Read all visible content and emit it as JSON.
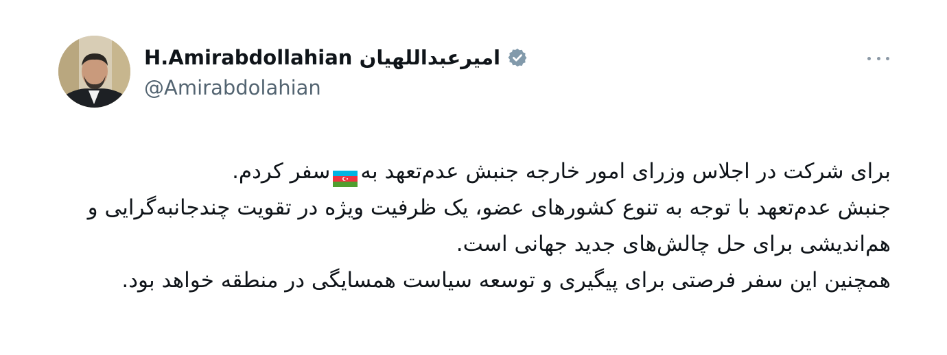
{
  "author": {
    "display_name": "H.Amirabdollahian امیرعبداللهیان",
    "handle": "@Amirabdolahian",
    "verified": true,
    "avatar_icon": "profile-photo"
  },
  "menu": {
    "icon": "more-dots-icon"
  },
  "tweet": {
    "line1_before_flag": "برای شرکت در اجلاس وزرای امور خارجه جنبش عدم‌تعهد به",
    "flag_emoji": "🇦🇿",
    "line1_after_flag": "سفر کردم.",
    "line2": "جنبش عدم‌تعهد با توجه به تنوع کشورهای عضو، یک ظرفیت ویژه در تقویت چندجانبه‌گرایی و هم‌اندیشی برای حل چالش‌های جدید جهانی است.",
    "line3": "همچنین این سفر فرصتی برای پیگیری و توسعه سیاست همسایگی در منطقه خواهد بود."
  },
  "colors": {
    "text": "#0f1419",
    "secondary": "#536471",
    "verified_badge": "#829aab"
  }
}
